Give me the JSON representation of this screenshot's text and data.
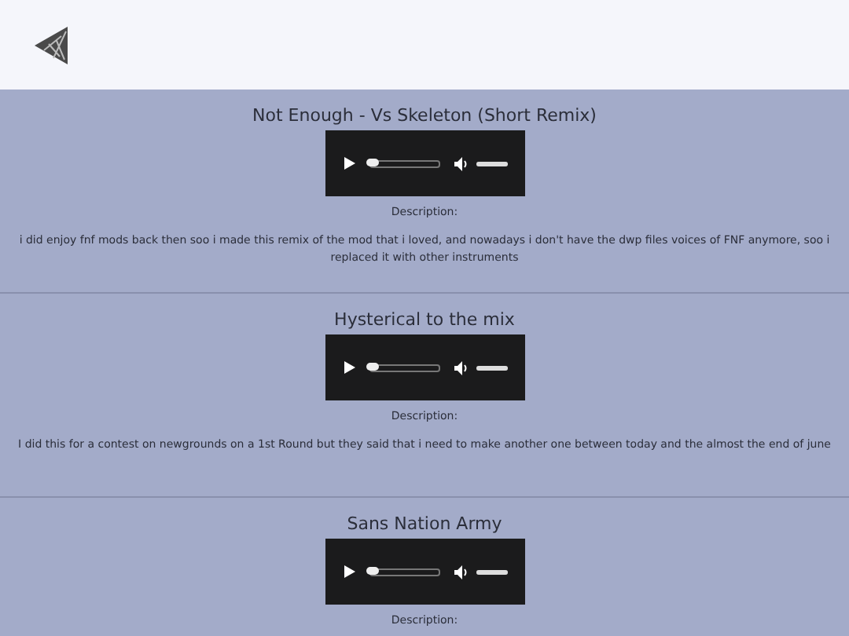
{
  "tracks": [
    {
      "title": "Not Enough - Vs Skeleton (Short Remix)",
      "player": {
        "progress": {
          "level": 0
        },
        "volume": {
          "level": 1
        }
      },
      "description_label": "Description:",
      "description": "i did enjoy fnf mods back then soo i made this remix of the mod that i loved, and nowadays i don't have the dwp files voices of FNF anymore, soo i replaced it with other instruments"
    },
    {
      "title": "Hysterical to the mix",
      "player": {
        "progress": {
          "level": 0
        },
        "volume": {
          "level": 1
        }
      },
      "description_label": "Description:",
      "description": "I did this for a contest on newgrounds on a 1st Round but they said that i need to make another one between today and the almost the end of june"
    },
    {
      "title": "Sans Nation Army",
      "player": {
        "progress": {
          "level": 0
        },
        "volume": {
          "level": 1
        }
      },
      "description_label": "Description:"
    }
  ]
}
